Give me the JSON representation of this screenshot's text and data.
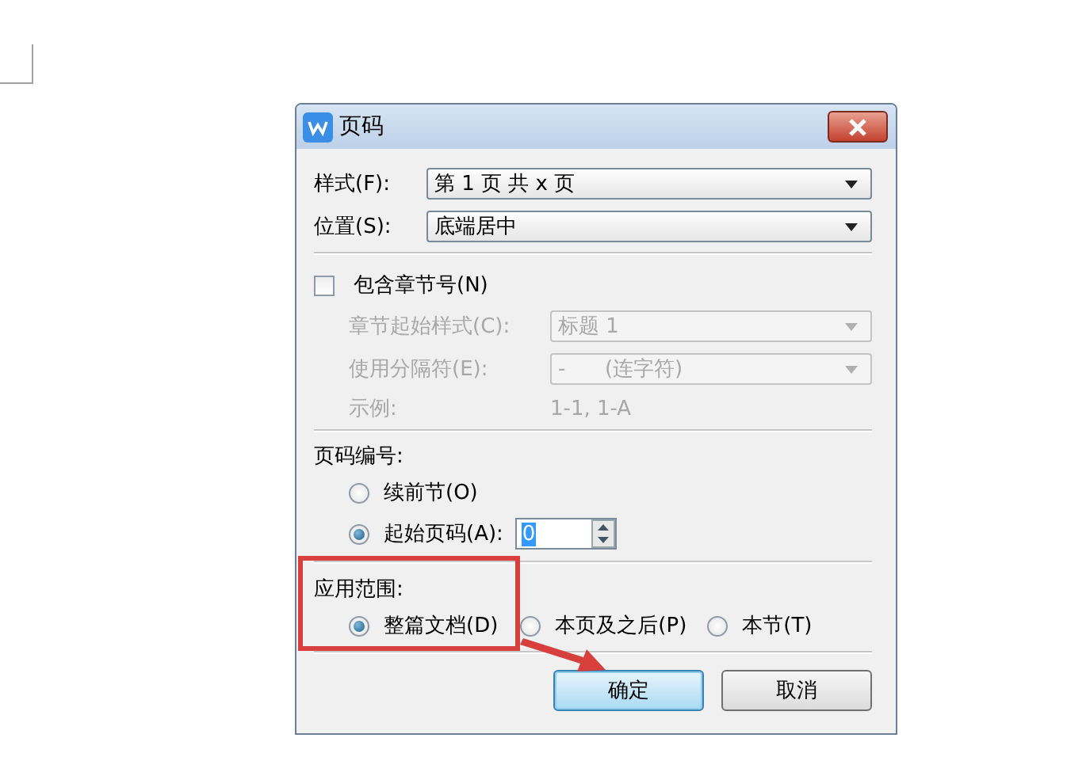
{
  "window": {
    "title": "页码"
  },
  "style": {
    "label": "样式(F):",
    "value": "第 1 页 共 x 页"
  },
  "position": {
    "label": "位置(S):",
    "value": "底端居中"
  },
  "include_chapter": {
    "label": "包含章节号(N)",
    "checked": false
  },
  "chapter_fields": [
    {
      "kind": "dropdown",
      "label": "章节起始样式(C):",
      "value": "标题 1",
      "disabled": true
    },
    {
      "kind": "dropdown",
      "label": "使用分隔符(E):",
      "value": "-      (连字符)",
      "disabled": true
    },
    {
      "kind": "text",
      "label": "示例:",
      "value": "1-1, 1-A",
      "disabled": true
    }
  ],
  "numbering": {
    "heading": "页码编号:",
    "options": [
      {
        "label": "续前节(O)",
        "selected": false
      },
      {
        "label": "起始页码(A):",
        "selected": true
      }
    ],
    "start_value": "0"
  },
  "scope": {
    "heading": "应用范围:",
    "options": [
      {
        "label": "整篇文档(D)",
        "selected": true
      },
      {
        "label": "本页及之后(P)",
        "selected": false
      },
      {
        "label": "本节(T)",
        "selected": false
      }
    ]
  },
  "buttons": [
    {
      "label": "确定",
      "kind": "default"
    },
    {
      "label": "取消",
      "kind": "normal"
    }
  ],
  "annotations": {
    "highlight_box": true,
    "arrow": true
  }
}
